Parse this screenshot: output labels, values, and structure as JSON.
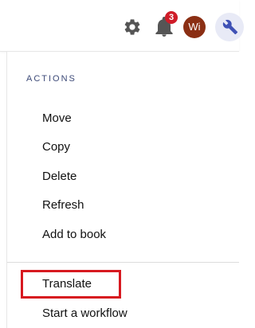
{
  "header": {
    "notifications_count": "3",
    "avatar_initials": "Wi",
    "icons": [
      "gear-icon",
      "bell-icon",
      "wrench-icon"
    ]
  },
  "actions": {
    "title": "ACTIONS",
    "items": [
      "Move",
      "Copy",
      "Delete",
      "Refresh",
      "Add to book"
    ]
  },
  "more_actions": {
    "items": [
      "Translate",
      "Start a workflow"
    ]
  },
  "colors": {
    "badge": "#cf1c28",
    "avatar": "#8b2f14",
    "highlight": "#d71920",
    "wrench_bg": "#e8eaf6",
    "wrench_icon": "#3f51b5",
    "icon_gray": "#555555",
    "section_title": "#3d4a78"
  }
}
